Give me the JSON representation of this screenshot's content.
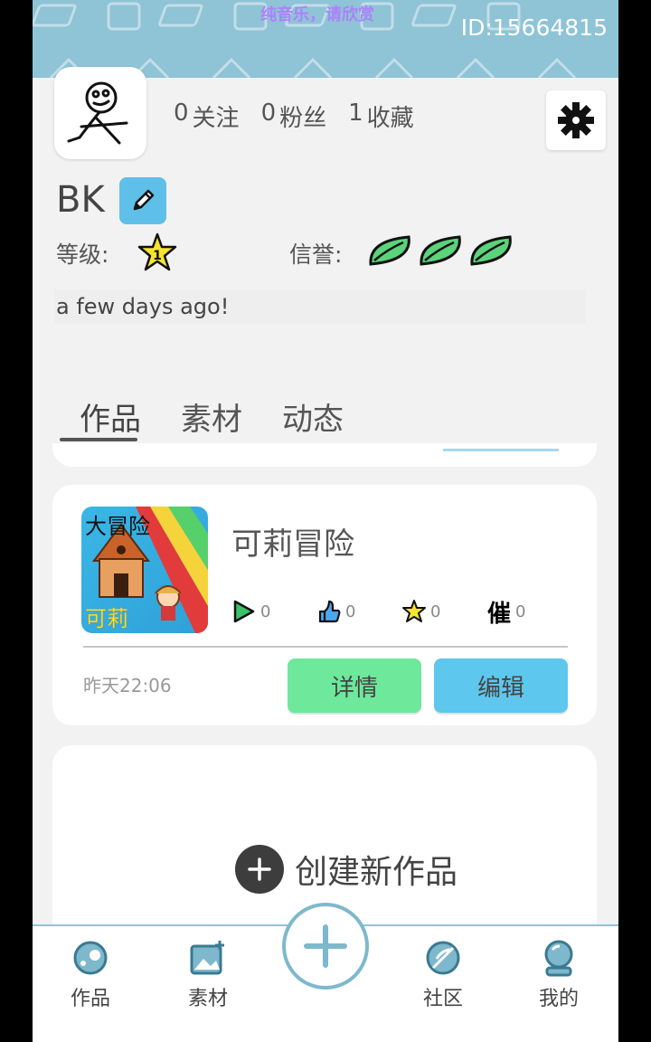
{
  "header": {
    "music_text": "纯音乐，请欣赏",
    "user_id": "ID:15664815"
  },
  "profile": {
    "stats": {
      "following_count": "0",
      "following_label": "关注",
      "fans_count": "0",
      "fans_label": "粉丝",
      "favorites_count": "1",
      "favorites_label": "收藏"
    },
    "username": "BK",
    "level_label": "等级:",
    "level_value": "1",
    "credit_label": "信誉:",
    "credit_leaves": 3,
    "bio": "a few days ago!"
  },
  "tabs": [
    {
      "label": "作品",
      "active": true
    },
    {
      "label": "素材",
      "active": false
    },
    {
      "label": "动态",
      "active": false
    }
  ],
  "work": {
    "title": "可莉冒险",
    "plays": "0",
    "likes": "0",
    "stars": "0",
    "urges": "0",
    "urge_glyph": "催",
    "time": "昨天22:06",
    "detail_label": "详情",
    "edit_label": "编辑",
    "thumb_text_top": "大冒险",
    "thumb_text_bottom": "可莉"
  },
  "create": {
    "label": "创建新作品"
  },
  "nav": {
    "works": "作品",
    "materials": "素材",
    "community": "社区",
    "mine": "我的"
  },
  "colors": {
    "header_bg": "#8fc3d6",
    "detail_btn": "#6ee89b",
    "edit_btn": "#5ec7ee",
    "edit_name_btn": "#5ebfe8",
    "nav_accent": "#7eb8cc"
  }
}
